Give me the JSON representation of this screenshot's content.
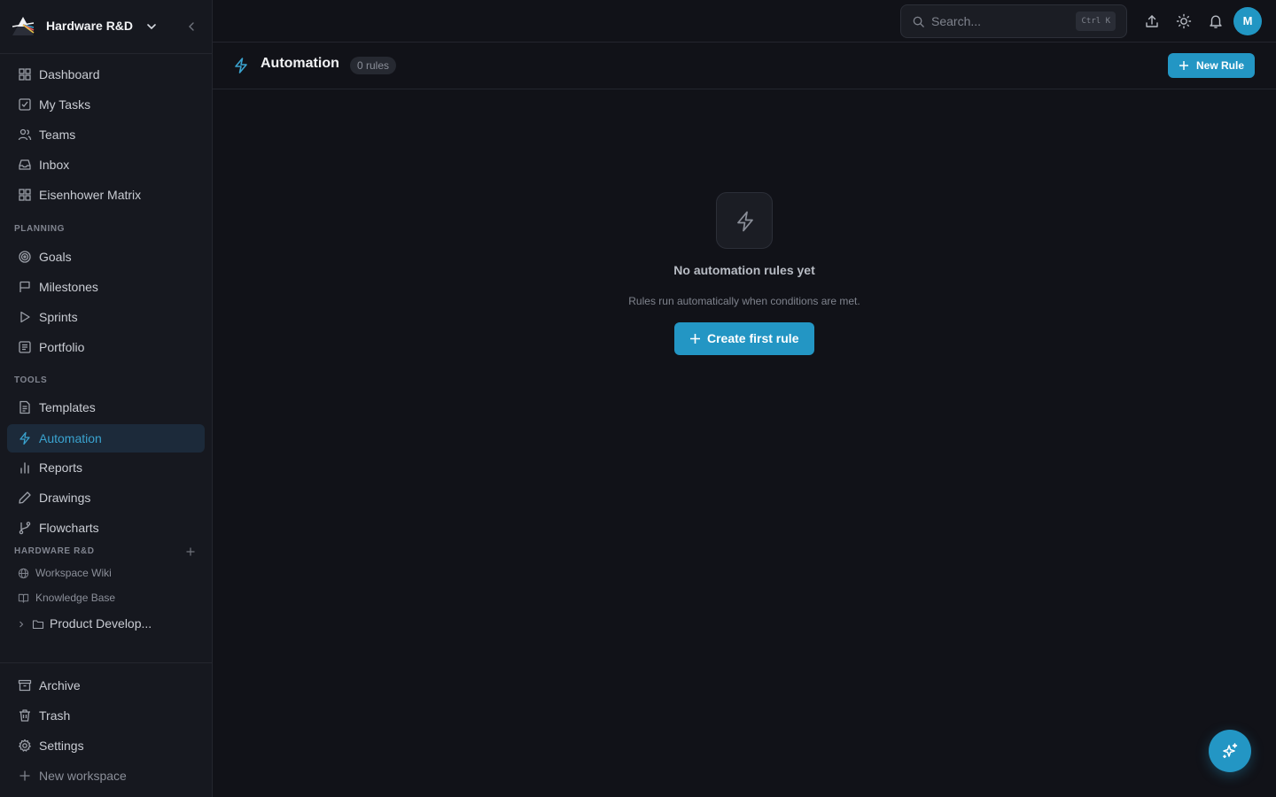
{
  "workspace": {
    "name": "Hardware R&D"
  },
  "nav": {
    "main": [
      {
        "label": "Dashboard",
        "icon": "dashboard-icon"
      },
      {
        "label": "My Tasks",
        "icon": "check-square-icon"
      },
      {
        "label": "Teams",
        "icon": "users-icon"
      },
      {
        "label": "Inbox",
        "icon": "inbox-icon"
      },
      {
        "label": "Eisenhower Matrix",
        "icon": "grid-icon"
      }
    ],
    "planning_label": "PLANNING",
    "planning": [
      {
        "label": "Goals",
        "icon": "target-icon"
      },
      {
        "label": "Milestones",
        "icon": "flag-icon"
      },
      {
        "label": "Sprints",
        "icon": "play-icon"
      },
      {
        "label": "Portfolio",
        "icon": "portfolio-icon"
      }
    ],
    "tools_label": "TOOLS",
    "tools": [
      {
        "label": "Templates",
        "icon": "file-text-icon"
      },
      {
        "label": "Automation",
        "icon": "zap-icon",
        "active": true
      },
      {
        "label": "Reports",
        "icon": "bar-chart-icon"
      },
      {
        "label": "Drawings",
        "icon": "pen-icon"
      },
      {
        "label": "Flowcharts",
        "icon": "git-branch-icon"
      }
    ],
    "workspace_section_label": "HARDWARE R&D",
    "workspace_items": [
      {
        "label": "Workspace Wiki",
        "icon": "globe-icon"
      },
      {
        "label": "Knowledge Base",
        "icon": "book-icon"
      }
    ],
    "folder": {
      "label": "Product Develop..."
    },
    "bottom": [
      {
        "label": "Archive",
        "icon": "archive-icon"
      },
      {
        "label": "Trash",
        "icon": "trash-icon"
      },
      {
        "label": "Settings",
        "icon": "gear-icon"
      },
      {
        "label": "New workspace",
        "icon": "plus-icon"
      }
    ]
  },
  "topbar": {
    "search_placeholder": "Search...",
    "search_shortcut": "Ctrl K",
    "avatar_initial": "M"
  },
  "page": {
    "title": "Automation",
    "badge": "0 rules",
    "new_rule_label": "New Rule"
  },
  "empty_state": {
    "title": "No automation rules yet",
    "subtitle": "Rules run automatically when conditions are met.",
    "cta_label": "Create first rule"
  },
  "colors": {
    "accent": "#2396c4",
    "active_text": "#3aa3cf",
    "background": "#111218",
    "sidebar": "#16181f"
  }
}
